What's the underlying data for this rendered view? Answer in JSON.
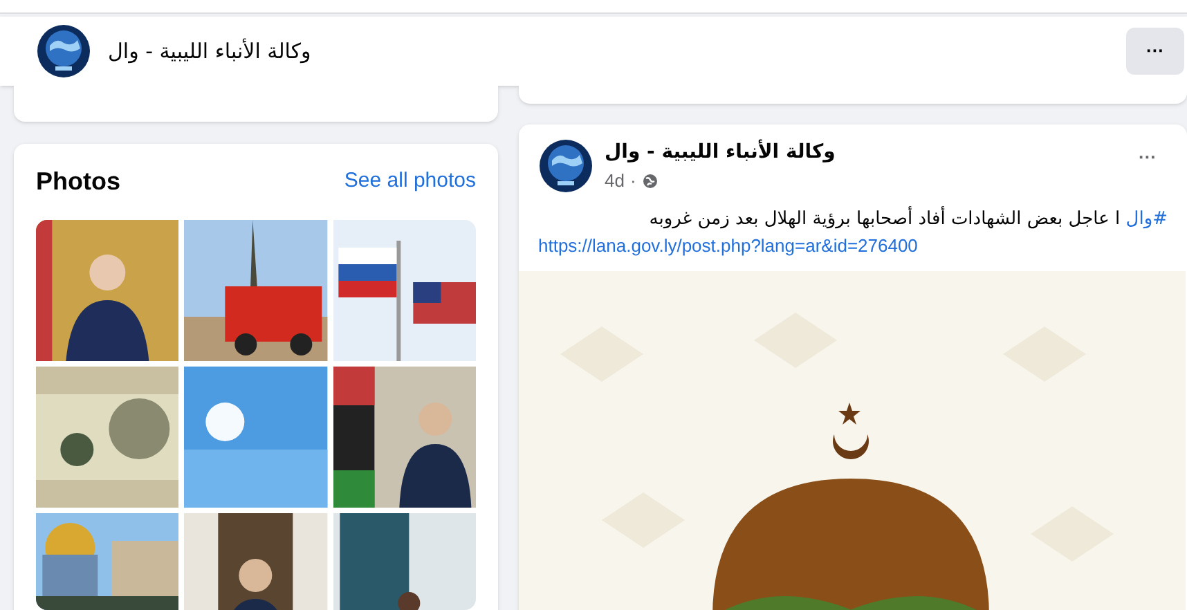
{
  "page_header": {
    "name": "وكالة الأنباء الليبية - وال",
    "more_button": "···"
  },
  "photos_card": {
    "title": "Photos",
    "see_all": "See all photos"
  },
  "post": {
    "author": "وكالة الأنباء الليبية - وال",
    "time": "4d",
    "separator": "·",
    "more_button": "···",
    "hashtag": "#وال",
    "text": "ا عاجل بعض الشهادات أفاد أصحابها برؤية الهلال بعد زمن غروبه",
    "link": "https://lana.gov.ly/post.php?lang=ar&id=276400"
  }
}
